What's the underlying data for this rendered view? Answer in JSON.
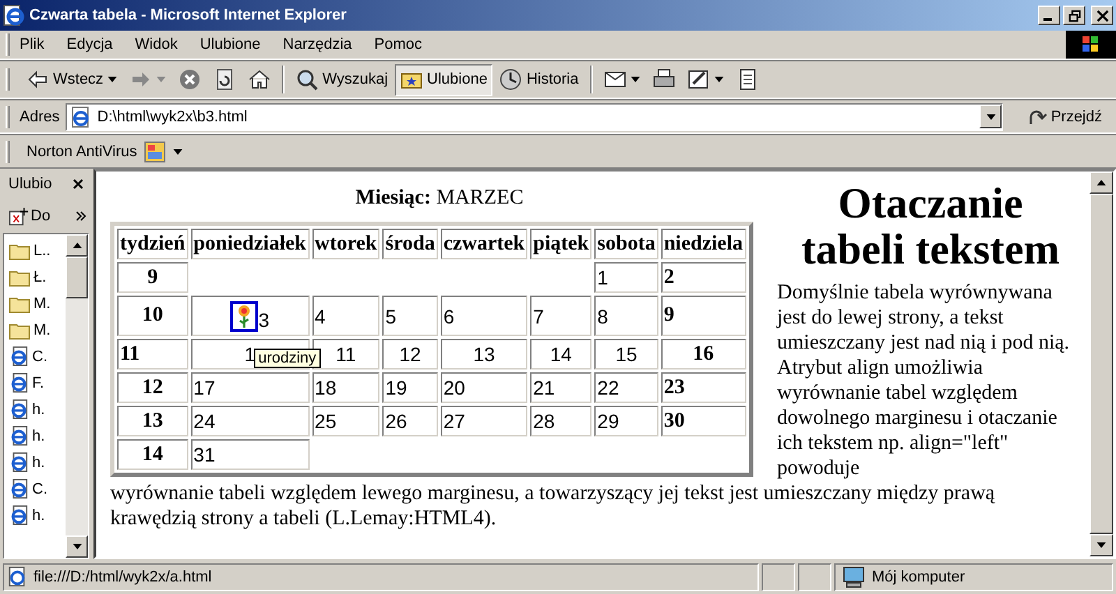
{
  "window": {
    "title": "Czwarta tabela - Microsoft Internet Explorer"
  },
  "menu": [
    "Plik",
    "Edycja",
    "Widok",
    "Ulubione",
    "Narzędzia",
    "Pomoc"
  ],
  "toolbar": [
    {
      "kind": "back",
      "label": "Wstecz",
      "selected": false
    },
    {
      "kind": "forward",
      "selected": false
    },
    {
      "kind": "stop",
      "selected": false
    },
    {
      "kind": "refresh",
      "selected": false
    },
    {
      "kind": "home",
      "selected": false
    },
    {
      "kind": "search",
      "label": "Wyszukaj",
      "selected": false
    },
    {
      "kind": "favorites",
      "label": "Ulubione",
      "selected": true
    },
    {
      "kind": "history",
      "label": "Historia",
      "selected": false
    },
    {
      "kind": "mail",
      "selected": false
    },
    {
      "kind": "print",
      "selected": false
    },
    {
      "kind": "edit",
      "selected": false
    },
    {
      "kind": "discuss",
      "selected": false
    }
  ],
  "address": {
    "label": "Adres",
    "value": "D:\\html\\wyk2x\\b3.html",
    "go": "Przejdź"
  },
  "links_bar": {
    "label": "Norton AntiVirus"
  },
  "sidebar": {
    "title": "Ulubio",
    "add": "Do",
    "items": [
      {
        "kind": "folder",
        "label": "L.."
      },
      {
        "kind": "folder",
        "label": "Ł."
      },
      {
        "kind": "folder",
        "label": "M."
      },
      {
        "kind": "folder",
        "label": "M."
      },
      {
        "kind": "page",
        "label": "C."
      },
      {
        "kind": "page",
        "label": "F."
      },
      {
        "kind": "page",
        "label": "h."
      },
      {
        "kind": "page",
        "label": "h."
      },
      {
        "kind": "page",
        "label": "h."
      },
      {
        "kind": "page",
        "label": "C."
      },
      {
        "kind": "page",
        "label": "h."
      }
    ]
  },
  "page": {
    "caption": "**Miesiąc:** MARZEC",
    "heading": "Otaczanie tabeli tekstem",
    "text_beside": "Domyślnie tabela wyrównywana jest do lewej strony, a tekst umieszczany jest nad nią i pod nią. Atrybut align umożliwia wyrównanie tabel względem dowolnego marginesu i otaczanie ich tekstem np. align=\"left\" powoduje",
    "text_below": "wyrównanie tabeli względem lewego marginesu, a towarzyszący jej tekst jest umieszczany między prawą krawędzią strony a tabeli (L.Lemay:HTML4).",
    "table": {
      "columns": [
        "tydzień",
        "poniedziałek",
        "wtorek",
        "środa",
        "czwartek",
        "piątek",
        "sobota",
        "niedziela"
      ],
      "rows": [
        {
          "kind": "plain",
          "cells": [
            {
              "text": "9"
            },
            "",
            "",
            "",
            "",
            "",
            {
              "text": "1"
            },
            {
              "text": "2"
            }
          ]
        },
        {
          "kind": "plain",
          "cells": [
            {
              "text": "10"
            },
            {
              "text": "3",
              "kind": "image-link",
              "tooltip": "urodziny"
            },
            {
              "text": "4"
            },
            {
              "text": "5"
            },
            {
              "text": "6"
            },
            {
              "text": "7"
            },
            {
              "text": "8"
            },
            {
              "text": "9"
            }
          ]
        },
        {
          "kind": "centered",
          "cells": [
            {
              "text": "11"
            },
            {
              "text": "1"
            },
            {
              "text": "11"
            },
            {
              "text": "12"
            },
            {
              "text": "13"
            },
            {
              "text": "14"
            },
            {
              "text": "15"
            },
            {
              "text": "16"
            }
          ]
        },
        {
          "kind": "plain",
          "cells": [
            {
              "text": "12"
            },
            {
              "text": "17"
            },
            {
              "text": "18"
            },
            {
              "text": "19"
            },
            {
              "text": "20"
            },
            {
              "text": "21"
            },
            {
              "text": "22"
            },
            {
              "text": "23"
            }
          ]
        },
        {
          "kind": "plain",
          "cells": [
            {
              "text": "13"
            },
            {
              "text": "24"
            },
            {
              "text": "25"
            },
            {
              "text": "26"
            },
            {
              "text": "27"
            },
            {
              "text": "28"
            },
            {
              "text": "29"
            },
            {
              "text": "30"
            }
          ]
        },
        {
          "kind": "plain",
          "cells": [
            {
              "text": "14"
            },
            {
              "text": "31"
            },
            "",
            "",
            "",
            "",
            "",
            ""
          ]
        }
      ]
    }
  },
  "status_bar": {
    "text": "file:///D:/html/wyk2x/a.html",
    "zone": "Mój komputer"
  }
}
